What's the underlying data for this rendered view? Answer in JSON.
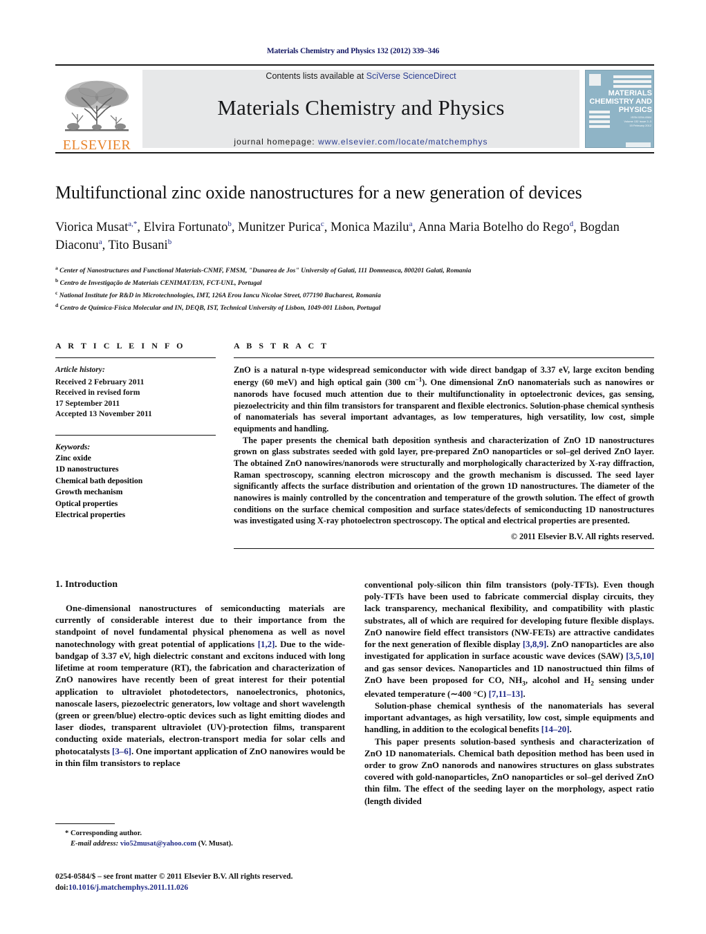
{
  "running_head": "Materials Chemistry and Physics 132 (2012) 339–346",
  "masthead": {
    "contents_prefix": "Contents lists available at ",
    "contents_link": "SciVerse ScienceDirect",
    "journal_title": "Materials Chemistry and Physics",
    "homepage_prefix": "journal homepage: ",
    "homepage_link": "www.elsevier.com/locate/matchemphys",
    "publisher_word": "ELSEVIER",
    "cover": {
      "line1": "MATERIALS",
      "line2": "CHEMISTRY AND",
      "line3": "PHYSICS",
      "meta1": "ISSN 0254-0584",
      "meta2": "Volume 132  Issue 2–3",
      "meta3": "15 February 2012",
      "footer": "ScienceDirect"
    },
    "colors": {
      "link_blue": "#2b3d92",
      "banner_grey": "#e7e8e9",
      "elsevier_orange": "#e8832a",
      "cover_blue": "#8fb4c6"
    }
  },
  "article": {
    "title": "Multifunctional zinc oxide nanostructures for a new generation of devices",
    "authors": [
      {
        "name": "Viorica Musat",
        "sup": "a,*"
      },
      {
        "name": "Elvira Fortunato",
        "sup": "b"
      },
      {
        "name": "Munitzer Purica",
        "sup": "c"
      },
      {
        "name": "Monica Mazilu",
        "sup": "a"
      },
      {
        "name": "Anna Maria Botelho do Rego",
        "sup": "d"
      },
      {
        "name": "Bogdan Diaconu",
        "sup": "a"
      },
      {
        "name": "Tito Busani",
        "sup": "b"
      }
    ],
    "affiliations": [
      {
        "mark": "a",
        "text": "Center of Nanostructures and Functional Materials-CNMF, FMSM, \"Dunarea de Jos\" University of Galati, 111 Domneasca, 800201 Galati, Romania"
      },
      {
        "mark": "b",
        "text": "Centro de Investigação de Materiais CENIMAT/I3N, FCT-UNL, Portugal"
      },
      {
        "mark": "c",
        "text": "National Institute for R&D in Microtechnologies, IMT, 126A Erou Iancu Nicolae Street, 077190 Bucharest, Romania"
      },
      {
        "mark": "d",
        "text": "Centro de Química-Física Molecular and IN, DEQB, IST, Technical University of Lisbon, 1049-001 Lisbon, Portugal"
      }
    ]
  },
  "article_info": {
    "heading": "A R T I C L E   I N F O",
    "history_label": "Article history:",
    "history": [
      "Received 2 February 2011",
      "Received in revised form",
      "17 September 2011",
      "Accepted 13 November 2011"
    ],
    "keywords_label": "Keywords:",
    "keywords": [
      "Zinc oxide",
      "1D nanostructures",
      "Chemical bath deposition",
      "Growth mechanism",
      "Optical properties",
      "Electrical properties"
    ]
  },
  "abstract": {
    "heading": "A B S T R A C T",
    "para1_a": "ZnO is a natural n-type widespread semiconductor with wide direct bandgap of 3.37 eV, large exciton bending energy (60 meV) and high optical gain (300 cm",
    "para1_sup": "−1",
    "para1_b": "). One dimensional ZnO nanomaterials such as nanowires or nanorods have focused much attention due to their multifunctionality in optoelectronic devices, gas sensing, piezoelectricity and thin film transistors for transparent and flexible electronics. Solution-phase chemical synthesis of nanomaterials has several important advantages, as low temperatures, high versatility, low cost, simple equipments and handling.",
    "para2": "The paper presents the chemical bath deposition synthesis and characterization of ZnO 1D nanostructures grown on glass substrates seeded with gold layer, pre-prepared ZnO nanoparticles or sol–gel derived ZnO layer. The obtained ZnO nanowires/nanorods were structurally and morphologically characterized by X-ray diffraction, Raman spectroscopy, scanning electron microscopy and the growth mechanism is discussed. The seed layer significantly affects the surface distribution and orientation of the grown 1D nanostructures. The diameter of the nanowires is mainly controlled by the concentration and temperature of the growth solution. The effect of growth conditions on the surface chemical composition and surface states/defects of semiconducting 1D nanostructures was investigated using X-ray photoelectron spectroscopy. The optical and electrical properties are presented.",
    "copyright": "© 2011 Elsevier B.V. All rights reserved."
  },
  "body": {
    "section_number_title": "1.  Introduction",
    "left_p1_a": "One-dimensional nanostructures of semiconducting materials are currently of considerable interest due to their importance from the standpoint of novel fundamental physical phenomena as well as novel nanotechnology with great potential of applications ",
    "left_ref1": "[1,2]",
    "left_p1_b": ". Due to the wide-bandgap of 3.37 eV, high dielectric constant and excitons induced with long lifetime at room temperature (RT), the fabrication and characterization of ZnO nanowires have recently been of great interest for their potential application to ultraviolet photodetectors, nanoelectronics, photonics, nanoscale lasers, piezoelectric generators, low voltage and short wavelength (green or green/blue) electro-optic devices such as light emitting diodes and laser diodes, transparent ultraviolet (UV)-protection films, transparent conducting oxide materials, electron-transport media for solar cells and photocatalysts ",
    "left_ref2": "[3–6]",
    "left_p1_c": ". One important application of ZnO nanowires would be in thin film transistors to replace",
    "footnote_star": "* Corresponding author.",
    "footnote_email_label": "E-mail address:",
    "footnote_email": "vio52musat@yahoo.com",
    "footnote_email_tail": " (V. Musat).",
    "right_p1_a": "conventional poly-silicon thin film transistors (poly-TFTs). Even though poly-TFTs have been used to fabricate commercial display circuits, they lack transparency, mechanical flexibility, and compatibility with plastic substrates, all of which are required for developing future flexible displays. ZnO nanowire field effect transistors (NW-FETs) are attractive candidates for the next generation of flexible display ",
    "right_ref1": "[3,8,9]",
    "right_p1_b": ". ZnO nanoparticles are also investigated for application in surface acoustic wave devices (SAW) ",
    "right_ref2": "[3,5,10]",
    "right_p1_c": " and gas sensor devices. Nanoparticles and 1D nanostructued thin films of ZnO have been proposed for CO, NH",
    "right_sub1": "3",
    "right_p1_d": ", alcohol and H",
    "right_sub2": "2",
    "right_p1_e": " sensing under elevated temperature (∼400 °C) ",
    "right_ref3": "[7,11–13]",
    "right_p1_f": ".",
    "right_p2_a": "Solution-phase chemical synthesis of the nanomaterials has several important advantages, as high versatility, low cost, simple equipments and handling, in addition to the ecological benefits ",
    "right_ref4": "[14–20]",
    "right_p2_b": ".",
    "right_p3": "This paper presents solution-based synthesis and characterization of ZnO 1D nanomaterials. Chemical bath deposition method has been used in order to grow ZnO nanorods and nanowires structures on glass substrates covered with gold-nanoparticles, ZnO nanoparticles or sol–gel derived ZnO thin film. The effect of the seeding layer on the morphology, aspect ratio (length divided"
  },
  "page_footer": {
    "line1": "0254-0584/$ – see front matter © 2011 Elsevier B.V. All rights reserved.",
    "doi_label": "doi:",
    "doi": "10.1016/j.matchemphys.2011.11.026"
  }
}
